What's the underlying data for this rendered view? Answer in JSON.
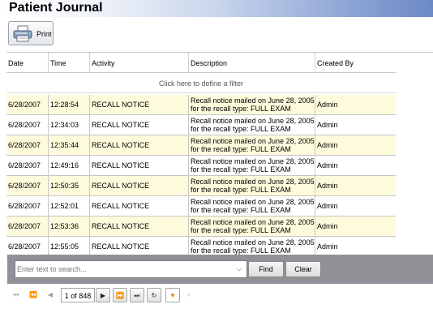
{
  "window": {
    "title": "Patient Journal"
  },
  "toolbar": {
    "print_label": "Print",
    "print_icon": "printer-icon"
  },
  "grid": {
    "columns": [
      "Date",
      "Time",
      "Activity",
      "Description",
      "Created By"
    ],
    "filter_hint": "Click here to define a filter",
    "rows": [
      {
        "date": "6/28/2007",
        "time": "12:28:54",
        "activity": "RECALL NOTICE",
        "desc1": "Recall notice mailed on June 28, 2005",
        "desc2": "for the recall type:  FULL EXAM",
        "created_by": "Admin"
      },
      {
        "date": "6/28/2007",
        "time": "12:34:03",
        "activity": "RECALL NOTICE",
        "desc1": "Recall notice mailed on June 28, 2005",
        "desc2": "for the recall type:  FULL EXAM",
        "created_by": "Admin"
      },
      {
        "date": "6/28/2007",
        "time": "12:35:44",
        "activity": "RECALL NOTICE",
        "desc1": "Recall notice mailed on June 28, 2005",
        "desc2": "for the recall type:  FULL EXAM",
        "created_by": "Admin"
      },
      {
        "date": "6/28/2007",
        "time": "12:49:16",
        "activity": "RECALL NOTICE",
        "desc1": "Recall notice mailed on June 28, 2005",
        "desc2": "for the recall type:  FULL EXAM",
        "created_by": "Admin"
      },
      {
        "date": "6/28/2007",
        "time": "12:50:35",
        "activity": "RECALL NOTICE",
        "desc1": "Recall notice mailed on June 28, 2005",
        "desc2": "for the recall type:  FULL EXAM",
        "created_by": "Admin"
      },
      {
        "date": "6/28/2007",
        "time": "12:52:01",
        "activity": "RECALL NOTICE",
        "desc1": "Recall notice mailed on June 28, 2005",
        "desc2": "for the recall type:  FULL EXAM",
        "created_by": "Admin"
      },
      {
        "date": "6/28/2007",
        "time": "12:53:36",
        "activity": "RECALL NOTICE",
        "desc1": "Recall notice mailed on June 28, 2005",
        "desc2": "for the recall type:  FULL EXAM",
        "created_by": "Admin"
      },
      {
        "date": "6/28/2007",
        "time": "12:55:05",
        "activity": "RECALL NOTICE",
        "desc1": "Recall notice mailed on June 28, 2005",
        "desc2": "for the recall type:  FULL EXAM",
        "created_by": "Admin"
      }
    ]
  },
  "search": {
    "placeholder": "Enter text to search...",
    "find_label": "Find",
    "clear_label": "Clear"
  },
  "pager": {
    "page_info": "1 of 848",
    "icons": [
      "first-page-icon",
      "previous-page-group-icon",
      "previous-page-icon",
      "next-page-icon",
      "next-page-group-icon",
      "last-page-icon",
      "refresh-icon",
      "filter-icon",
      "collapse-icon"
    ]
  },
  "colors": {
    "row_alt": "#fefbdc",
    "title_gradient_end": "#6c89c6",
    "search_panel": "#8f9196"
  }
}
